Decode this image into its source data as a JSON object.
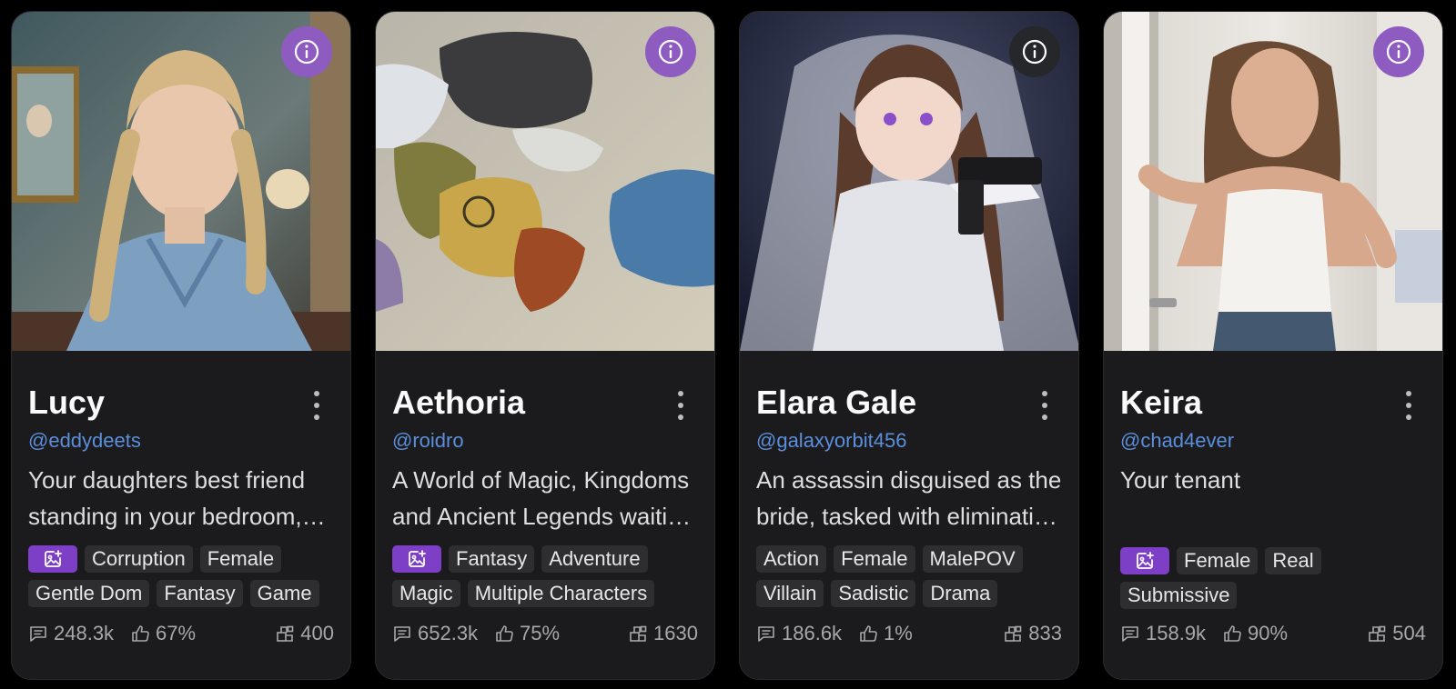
{
  "cards": [
    {
      "name": "Lucy",
      "handle": "@eddydeets",
      "description": "Your daughters best friend standing in your bedroom, looking at you with a shy expression",
      "has_image_tag": true,
      "tags": [
        "Corruption",
        "Female",
        "Gentle Dom",
        "Fantasy",
        "Game"
      ],
      "chats": "248.3k",
      "likes": "67%",
      "count": "400",
      "info_button_color": "#8e5cc0"
    },
    {
      "name": "Aethoria",
      "handle": "@roidro",
      "description": "A World of Magic, Kingdoms and Ancient Legends waiting to be explored",
      "has_image_tag": true,
      "tags": [
        "Fantasy",
        "Adventure",
        "Magic",
        "Multiple Characters"
      ],
      "chats": "652.3k",
      "likes": "75%",
      "count": "1630",
      "info_button_color": "#8e5cc0"
    },
    {
      "name": "Elara Gale",
      "handle": "@galaxyorbit456",
      "description": "An assassin disguised as the bride, tasked with eliminating the groom",
      "has_image_tag": false,
      "tags": [
        "Action",
        "Female",
        "MalePOV",
        "Villain",
        "Sadistic",
        "Drama"
      ],
      "chats": "186.6k",
      "likes": "1%",
      "count": "833",
      "info_button_color": "#26272a"
    },
    {
      "name": "Keira",
      "handle": "@chad4ever",
      "description": "Your tenant",
      "has_image_tag": true,
      "tags": [
        "Female",
        "Real",
        "Submissive"
      ],
      "chats": "158.9k",
      "likes": "90%",
      "count": "504",
      "info_button_color": "#8e5cc0"
    }
  ],
  "icons": {
    "info": "info-icon",
    "more": "more-vertical-icon",
    "image_tag": "image-plus-icon",
    "chats": "chat-bubble-icon",
    "likes": "thumbs-up-icon",
    "count": "blocks-icon"
  },
  "colors": {
    "card_background": "#1b1b1d",
    "handle": "#5b8fdc",
    "image_tag": "#7c3fc6",
    "tag_background": "#2e2e30"
  }
}
